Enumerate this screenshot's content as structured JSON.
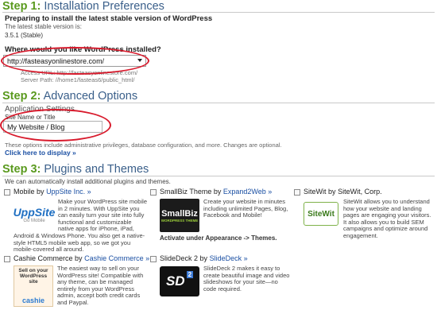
{
  "step1": {
    "step": "Step 1:",
    "title": "Installation Preferences",
    "preparing": "Preparing to install the latest stable version of WordPress",
    "latest_label": "The latest stable version is:",
    "version": "3.5.1 (Stable)",
    "where_label": "Where would you like WordPress installed?",
    "url_value": "http://fasteasyonlinestore.com/",
    "access_url": "Access URL: http://fasteasyonlinestore.com/",
    "server_path": "Server Path: //home1/fasteas6/public_html/"
  },
  "step2": {
    "step": "Step 2:",
    "title": "Advanced Options",
    "app_settings": "Application Settings",
    "site_name_label": "Site Name or Title",
    "site_name_value": "My Website / Blog",
    "options_note": "These options include administrative privileges, database configuration, and more. Changes are optional.",
    "display_link": "Click here to display",
    "display_arrow": "»"
  },
  "step3": {
    "step": "Step 3:",
    "title": "Plugins and Themes",
    "intro": "We can automatically install additional plugins and themes.",
    "by": "by",
    "plugins": [
      {
        "name": "Mobile",
        "vendor": "UppSite Inc.",
        "arrow": "»",
        "logo_text": "UppSite",
        "logo_sub": "Go Mobile",
        "desc": "Make your WordPress site mobile in 2 minutes. With UppSite you can easily turn your site into fully functional and customizable native apps for iPhone, iPad, Android & Windows Phone. You also get a native-style HTML5 mobile web app, so we got you mobile-covered all around."
      },
      {
        "name": "SmallBiz Theme",
        "vendor": "Expand2Web",
        "arrow": "»",
        "logo_text": "SmallBiz",
        "logo_sub": "WORDPRESS THEME",
        "desc": "Create your website in minutes including unlimited Pages, Blog, Facebook and Mobile!",
        "note": "Activate under Appearance -> Themes."
      },
      {
        "name": "SiteWit",
        "vendor": "SiteWit, Corp.",
        "logo_text": "SiteWit",
        "desc": "SiteWit allows you to understand how your website and landing pages are engaging your visitors. It also allows you to build SEM campaigns and optimize around engagement."
      },
      {
        "name": "Cashie Commerce",
        "vendor": "Cashie Commerce",
        "arrow": "»",
        "logo_text": "Sell on your WordPress site",
        "logo_brand": "cashie",
        "desc": "The easiest way to sell on your WordPress site! Compatible with any theme, can be managed entirely from your WordPress admin, accept both credit cards and Paypal."
      },
      {
        "name": "SlideDeck 2",
        "vendor": "SlideDeck",
        "arrow": "»",
        "logo_text": "SD",
        "logo_num": "2",
        "desc": "SlideDeck 2 makes it easy to create beautiful image and video slideshows for your site—no code required."
      }
    ]
  }
}
